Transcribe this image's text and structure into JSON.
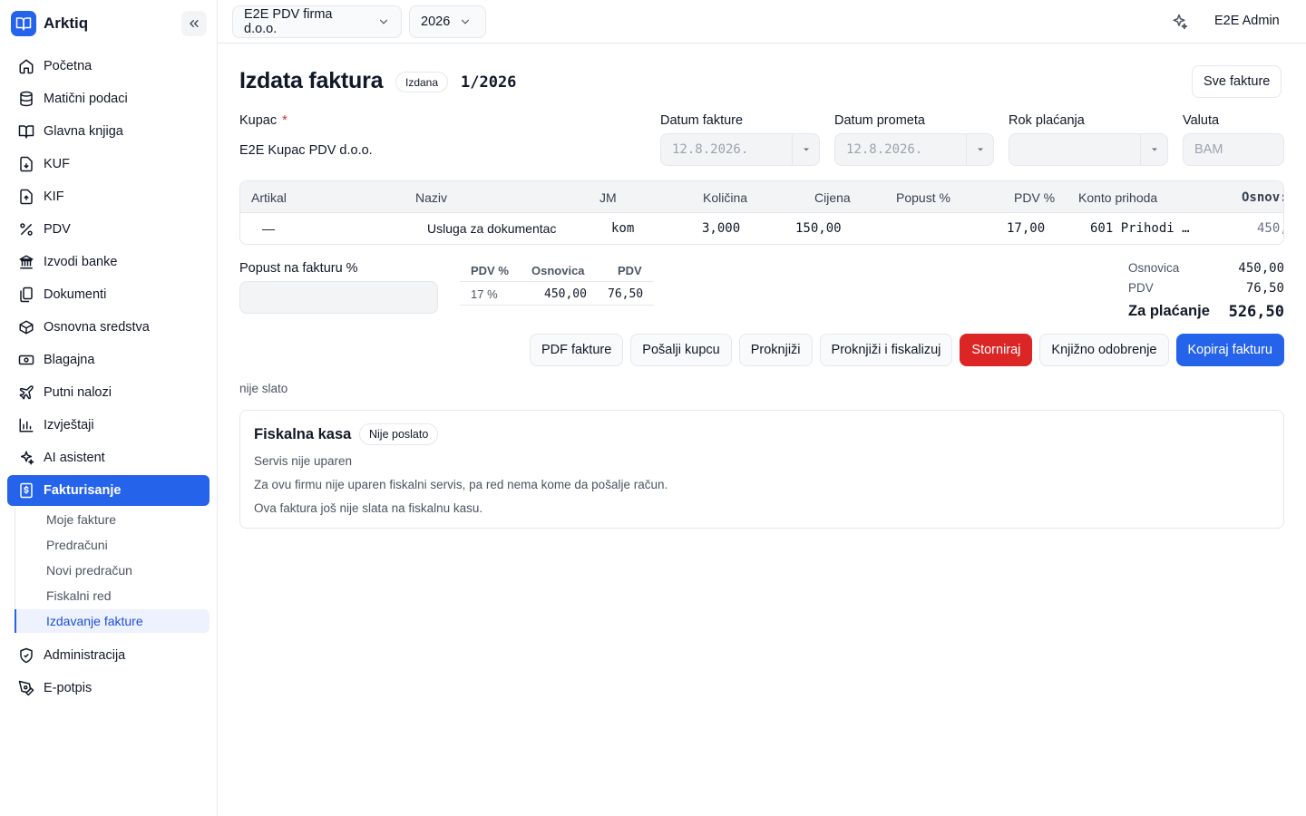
{
  "app": {
    "name": "Arktiq"
  },
  "topbar": {
    "company": "E2E PDV firma d.o.o.",
    "year": "2026",
    "user": "E2E Admin"
  },
  "sidebar": {
    "items": [
      {
        "label": "Početna",
        "icon": "home-icon"
      },
      {
        "label": "Matični podaci",
        "icon": "database-icon"
      },
      {
        "label": "Glavna knjiga",
        "icon": "book-icon"
      },
      {
        "label": "KUF",
        "icon": "file-in-icon"
      },
      {
        "label": "KIF",
        "icon": "file-out-icon"
      },
      {
        "label": "PDV",
        "icon": "percent-icon"
      },
      {
        "label": "Izvodi banke",
        "icon": "bank-icon"
      },
      {
        "label": "Dokumenti",
        "icon": "documents-icon"
      },
      {
        "label": "Osnovna sredstva",
        "icon": "box-icon"
      },
      {
        "label": "Blagajna",
        "icon": "cash-icon"
      },
      {
        "label": "Putni nalozi",
        "icon": "plane-icon"
      },
      {
        "label": "Izvještaji",
        "icon": "chart-icon"
      },
      {
        "label": "AI asistent",
        "icon": "sparkle-icon"
      },
      {
        "label": "Fakturisanje",
        "icon": "invoice-icon",
        "active": true
      }
    ],
    "subitems": [
      {
        "label": "Moje fakture"
      },
      {
        "label": "Predračuni"
      },
      {
        "label": "Novi predračun"
      },
      {
        "label": "Fiskalni red"
      },
      {
        "label": "Izdavanje fakture",
        "active": true
      }
    ],
    "bottom_items": [
      {
        "label": "Administracija",
        "icon": "shield-icon"
      },
      {
        "label": "E-potpis",
        "icon": "signature-icon"
      }
    ]
  },
  "invoice": {
    "title": "Izdata faktura",
    "status": "Izdana",
    "number": "1/2026",
    "all_invoices_label": "Sve fakture",
    "customer_label": "Kupac",
    "required_mark": "*",
    "customer": "E2E Kupac PDV d.o.o.",
    "invoice_date_label": "Datum fakture",
    "invoice_date": "12.8.2026.",
    "turnover_date_label": "Datum prometa",
    "turnover_date": "12.8.2026.",
    "due_label": "Rok plaćanja",
    "due_date": "",
    "currency_label": "Valuta",
    "currency": "BAM"
  },
  "items_table": {
    "headers": [
      "Artikal",
      "Naziv",
      "JM",
      "Količina",
      "Cijena",
      "Popust %",
      "PDV %",
      "Konto prihoda",
      "Osnov:"
    ],
    "rows": [
      {
        "artikal": "—",
        "naziv": "Usluga za dokumentac",
        "jm": "kom",
        "kolicina": "3,000",
        "cijena": "150,00",
        "popust": "",
        "pdv": "17,00",
        "konto": "601 Prihodi …",
        "osnovica": "450,"
      }
    ]
  },
  "discount": {
    "label": "Popust na fakturu %",
    "value": ""
  },
  "vat_summary": {
    "headers": [
      "PDV %",
      "Osnovica",
      "PDV"
    ],
    "rows": [
      {
        "rate": "17 %",
        "base": "450,00",
        "vat": "76,50"
      }
    ]
  },
  "totals": {
    "base_label": "Osnovica",
    "base": "450,00",
    "vat_label": "PDV",
    "vat": "76,50",
    "total_label": "Za plaćanje",
    "total": "526,50"
  },
  "actions": {
    "pdf": "PDF fakture",
    "send": "Pošalji kupcu",
    "post": "Proknjiži",
    "post_fiscal": "Proknjiži i fiskalizuj",
    "storno": "Storniraj",
    "credit_note": "Knjižno odobrenje",
    "copy": "Kopiraj fakturu"
  },
  "sent_status": "nije slato",
  "fiscal": {
    "title": "Fiskalna kasa",
    "badge": "Nije poslato",
    "line1": "Servis nije uparen",
    "line2": "Za ovu firmu nije uparen fiskalni servis, pa red nema kome da pošalje račun.",
    "line3": "Ova faktura još nije slata na fiskalnu kasu."
  },
  "colors": {
    "primary": "#2563eb",
    "danger": "#dc2626",
    "border": "#e5e7eb"
  }
}
